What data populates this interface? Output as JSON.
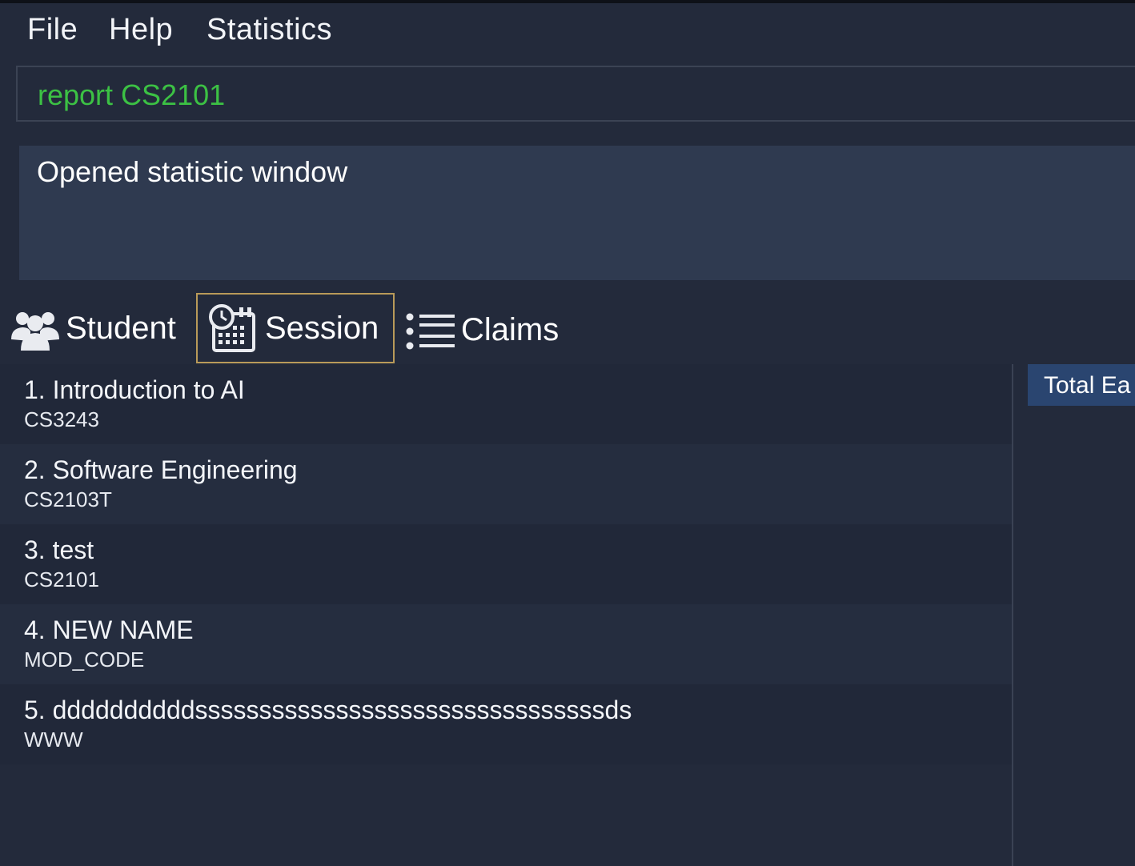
{
  "menu": {
    "file_label": "File",
    "help_label": "Help",
    "statistics_label": "Statistics"
  },
  "command": {
    "value": "report CS2101",
    "color": "#3cc144"
  },
  "result": {
    "message": "Opened statistic window"
  },
  "tabs": [
    {
      "label": "Student",
      "icon": "users-icon",
      "selected": false
    },
    {
      "label": "Session",
      "icon": "calendar-clock-icon",
      "selected": true
    },
    {
      "label": "Claims",
      "icon": "list-icon",
      "selected": false
    }
  ],
  "modules": [
    {
      "title": "1.  Introduction to AI",
      "code": "CS3243"
    },
    {
      "title": "2.  Software Engineering",
      "code": "CS2103T"
    },
    {
      "title": "3.  test",
      "code": "CS2101"
    },
    {
      "title": "4.  NEW NAME",
      "code": "MOD_CODE"
    },
    {
      "title": "5.  ddddddddddssssssssssssssssssssssssssssssssds",
      "code": "WWW"
    }
  ],
  "side_panel": {
    "header": "Total Ea"
  },
  "colors": {
    "background": "#232a3b",
    "selected_tab_border": "#b99a59",
    "side_header": "#2a4570"
  }
}
